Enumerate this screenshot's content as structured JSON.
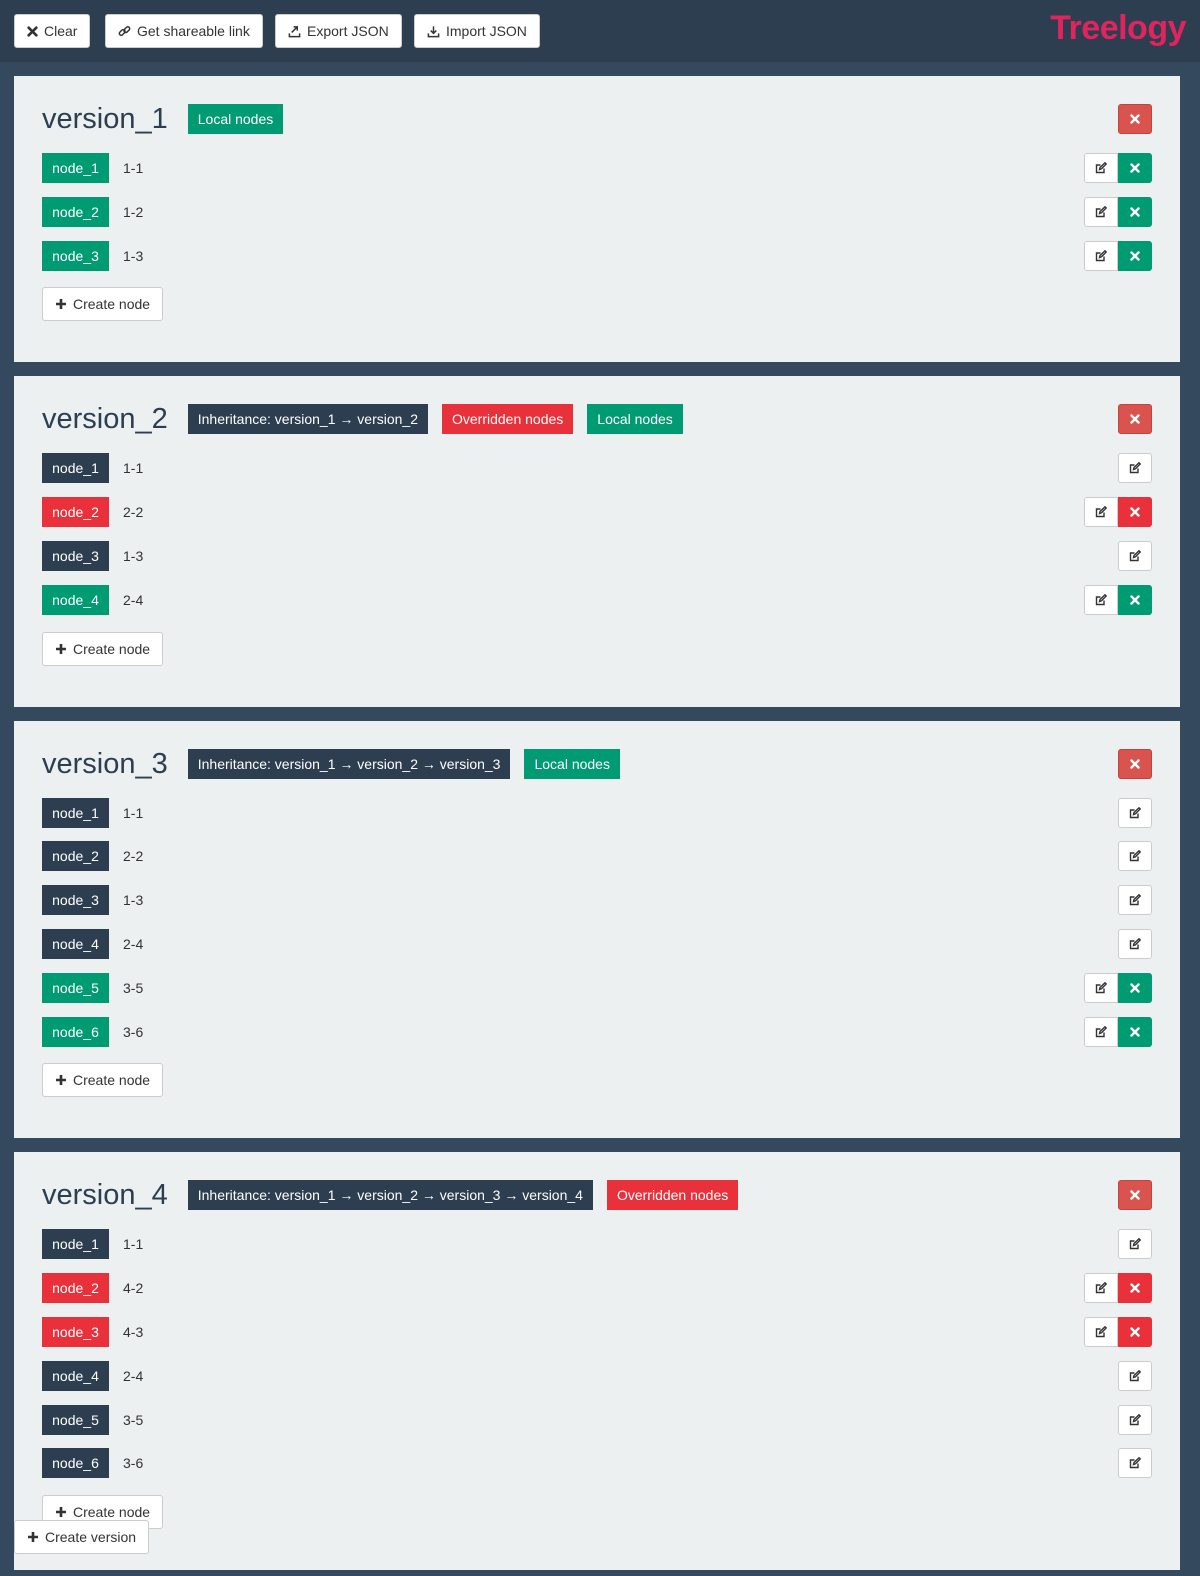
{
  "app": {
    "brand": "Treelogy",
    "toolbar": {
      "clear_label": "Clear",
      "share_label": "Get shareable link",
      "export_label": "Export JSON",
      "import_label": "Import JSON"
    },
    "create_version_label": "Create version",
    "create_node_label": "Create node"
  },
  "colors": {
    "brand": "#e0245e",
    "dark": "#2c3e50",
    "overridden": "#e8313a",
    "local": "#009a73",
    "delete_version": "#d9534f",
    "panel": "#ecf0f1",
    "background": "#34495e"
  },
  "icons": {
    "clear": "times-icon",
    "share": "link-icon",
    "export": "export-icon",
    "import": "import-icon",
    "edit": "edit-icon",
    "delete": "times-icon",
    "create": "plus-icon"
  },
  "versions": [
    {
      "name": "version_1",
      "tags": [
        {
          "text": "Local nodes",
          "type": "green"
        }
      ],
      "nodes": [
        {
          "name": "node_1",
          "value": "1-1",
          "type": "green",
          "deletable": true
        },
        {
          "name": "node_2",
          "value": "1-2",
          "type": "green",
          "deletable": true
        },
        {
          "name": "node_3",
          "value": "1-3",
          "type": "green",
          "deletable": true
        }
      ]
    },
    {
      "name": "version_2",
      "tags": [
        {
          "text": "Inheritance: version_1 → version_2",
          "type": "dark"
        },
        {
          "text": "Overridden nodes",
          "type": "red"
        },
        {
          "text": "Local nodes",
          "type": "green"
        }
      ],
      "nodes": [
        {
          "name": "node_1",
          "value": "1-1",
          "type": "dark",
          "deletable": false
        },
        {
          "name": "node_2",
          "value": "2-2",
          "type": "red",
          "deletable": true
        },
        {
          "name": "node_3",
          "value": "1-3",
          "type": "dark",
          "deletable": false
        },
        {
          "name": "node_4",
          "value": "2-4",
          "type": "green",
          "deletable": true
        }
      ]
    },
    {
      "name": "version_3",
      "tags": [
        {
          "text": "Inheritance: version_1 → version_2 → version_3",
          "type": "dark"
        },
        {
          "text": "Local nodes",
          "type": "green"
        }
      ],
      "nodes": [
        {
          "name": "node_1",
          "value": "1-1",
          "type": "dark",
          "deletable": false
        },
        {
          "name": "node_2",
          "value": "2-2",
          "type": "dark",
          "deletable": false
        },
        {
          "name": "node_3",
          "value": "1-3",
          "type": "dark",
          "deletable": false
        },
        {
          "name": "node_4",
          "value": "2-4",
          "type": "dark",
          "deletable": false
        },
        {
          "name": "node_5",
          "value": "3-5",
          "type": "green",
          "deletable": true
        },
        {
          "name": "node_6",
          "value": "3-6",
          "type": "green",
          "deletable": true
        }
      ]
    },
    {
      "name": "version_4",
      "tags": [
        {
          "text": "Inheritance: version_1 → version_2 → version_3 → version_4",
          "type": "dark"
        },
        {
          "text": "Overridden nodes",
          "type": "red"
        }
      ],
      "nodes": [
        {
          "name": "node_1",
          "value": "1-1",
          "type": "dark",
          "deletable": false
        },
        {
          "name": "node_2",
          "value": "4-2",
          "type": "red",
          "deletable": true
        },
        {
          "name": "node_3",
          "value": "4-3",
          "type": "red",
          "deletable": true
        },
        {
          "name": "node_4",
          "value": "2-4",
          "type": "dark",
          "deletable": false
        },
        {
          "name": "node_5",
          "value": "3-5",
          "type": "dark",
          "deletable": false
        },
        {
          "name": "node_6",
          "value": "3-6",
          "type": "dark",
          "deletable": false
        }
      ]
    }
  ]
}
